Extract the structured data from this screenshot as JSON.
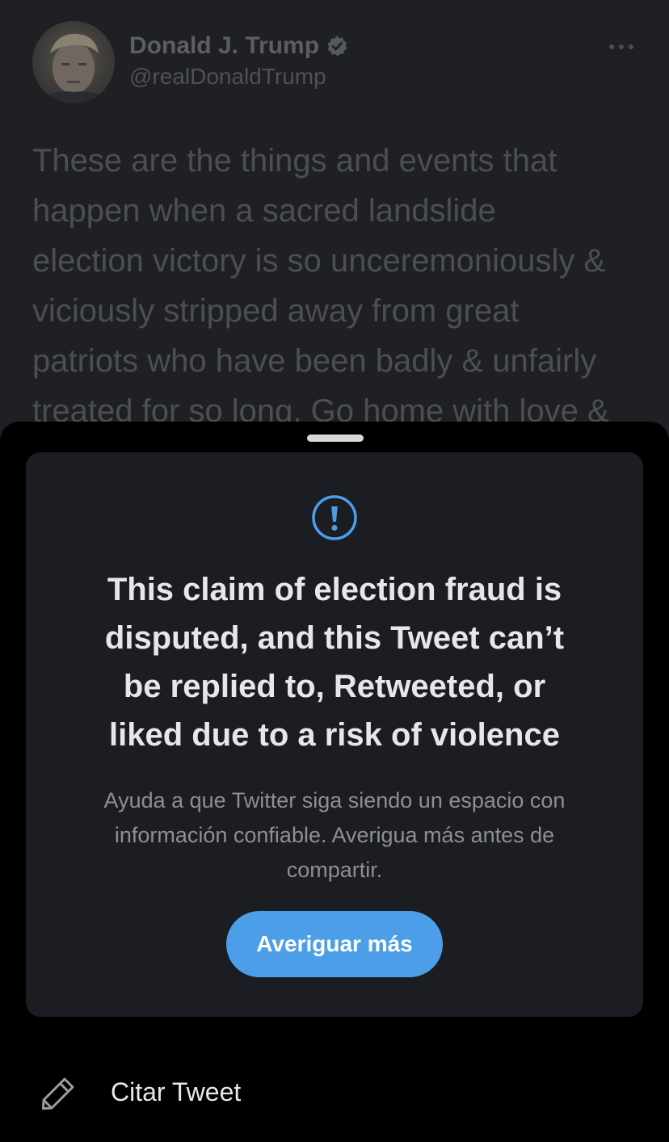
{
  "tweet": {
    "author_name": "Donald J. Trump",
    "author_handle": "@realDonaldTrump",
    "lines": [
      "These are the things and events that",
      "happen when a sacred landslide",
      "election victory is so unceremoniously &",
      "viciously stripped away from great",
      "patriots who have been badly & unfairly",
      "treated for so long. Go home with love &"
    ],
    "icons": {
      "verified": "verified-badge-icon",
      "more": "more-options-icon"
    }
  },
  "sheet": {
    "warning": {
      "icon": "alert-circle-icon",
      "title_lines": [
        "This claim of election fraud is",
        "disputed, and this Tweet can’t",
        "be replied to, Retweeted, or",
        "liked due to a risk of violence"
      ],
      "body_lines": [
        "Ayuda a que Twitter siga siendo un espacio con",
        "información confiable. Averigua más antes de",
        "compartir."
      ],
      "button_label": "Averiguar más"
    },
    "quote_action": {
      "icon": "pencil-icon",
      "label": "Citar Tweet"
    }
  },
  "colors": {
    "accent": "#4d9ee8",
    "sheet_background": "#000000",
    "card_background": "#1c1d22"
  }
}
